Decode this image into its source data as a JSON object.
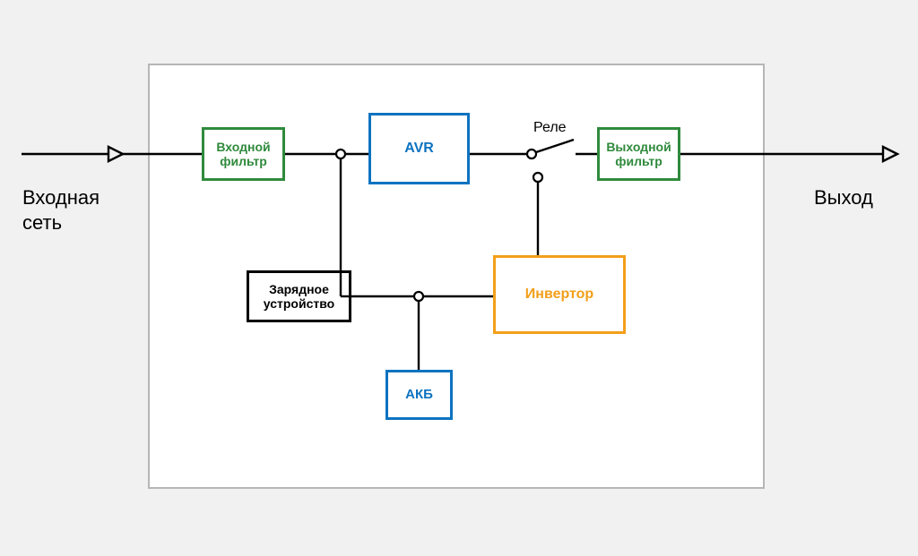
{
  "labels": {
    "input": "Входная\nсеть",
    "output": "Выход",
    "relay": "Реле"
  },
  "blocks": {
    "input_filter": "Входной фильтр",
    "avr": "AVR",
    "output_filter": "Выходной фильтр",
    "charger": "Зарядное устройство",
    "inverter": "Инвертор",
    "battery": "АКБ"
  },
  "colors": {
    "green": "#2f8a3c",
    "blue": "#0d73c0",
    "orange": "#f29f1a",
    "black": "#000000",
    "frame": "#b6b6b6"
  }
}
